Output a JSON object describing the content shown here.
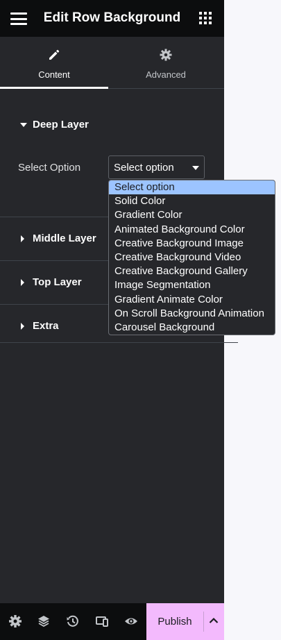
{
  "header": {
    "title": "Edit Row Background"
  },
  "tabs": [
    {
      "label": "Content",
      "icon": "pencil-icon",
      "active": true
    },
    {
      "label": "Advanced",
      "icon": "gear-icon",
      "active": false
    }
  ],
  "sections": {
    "deep_layer": "Deep Layer",
    "middle_layer": "Middle Layer",
    "top_layer": "Top Layer",
    "extra": "Extra"
  },
  "field": {
    "label": "Select Option",
    "value": "Select option"
  },
  "dropdown_options": [
    "Select option",
    "Solid Color",
    "Gradient Color",
    "Animated Background Color",
    "Creative Background Image",
    "Creative Background Video",
    "Creative Background Gallery",
    "Image Segmentation",
    "Gradient Animate Color",
    "On Scroll Background Animation",
    "Carousel Background"
  ],
  "footer": {
    "publish_label": "Publish",
    "icons": [
      "settings-icon",
      "layers-icon",
      "history-icon",
      "responsive-icon",
      "preview-icon"
    ]
  },
  "colors": {
    "panel_bg": "#26272b",
    "header_bg": "#0c0d0e",
    "publish_bg": "#f3bafd",
    "option_highlight": "#9cc4ff"
  }
}
